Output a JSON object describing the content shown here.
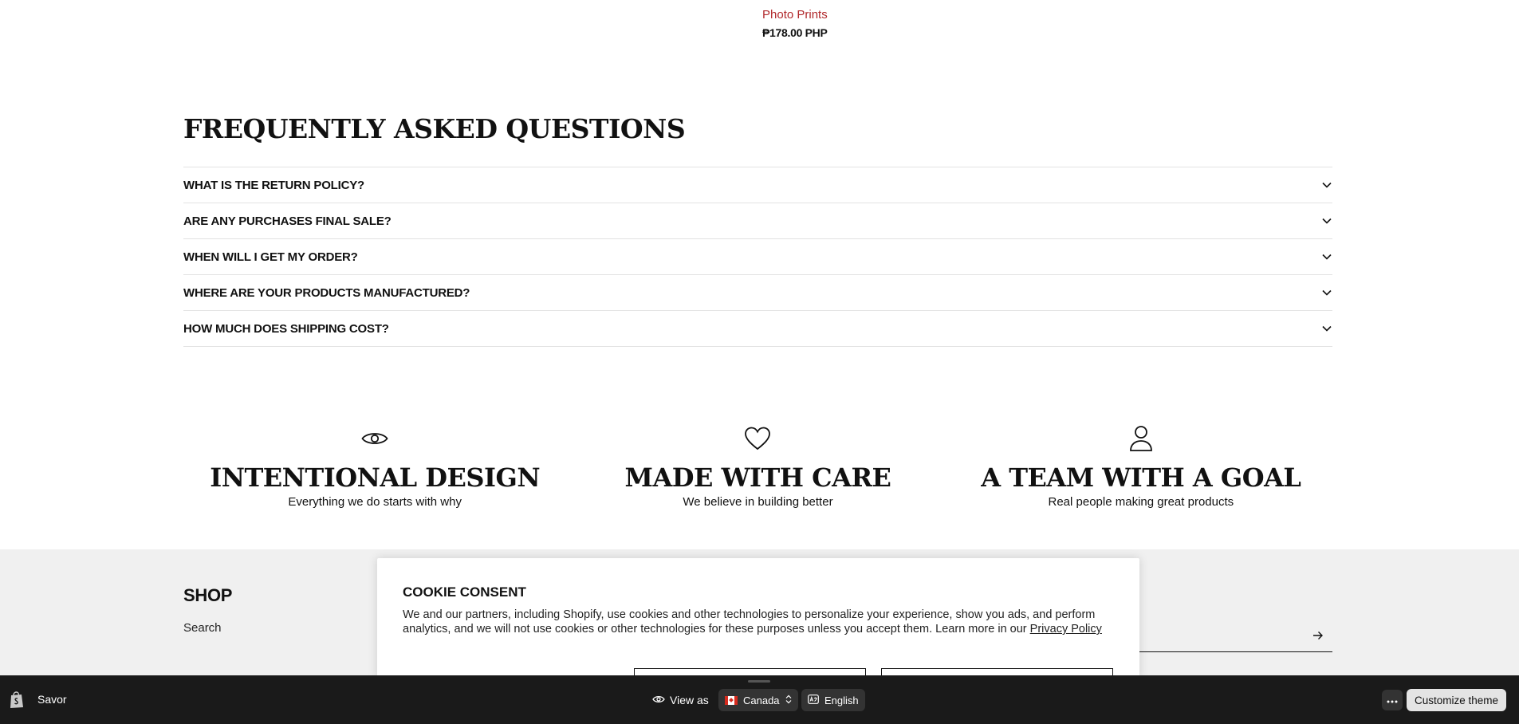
{
  "product": {
    "title": "Photo Prints",
    "price": "₱178.00 PHP"
  },
  "faq": {
    "title": "FREQUENTLY ASKED QUESTIONS",
    "items": [
      {
        "question": "WHAT IS THE RETURN POLICY?"
      },
      {
        "question": "ARE ANY PURCHASES FINAL SALE?"
      },
      {
        "question": "WHEN WILL I GET MY ORDER?"
      },
      {
        "question": "WHERE ARE YOUR PRODUCTS MANUFACTURED?"
      },
      {
        "question": "HOW MUCH DOES SHIPPING COST?"
      }
    ]
  },
  "values": [
    {
      "icon": "eye-icon",
      "title": "INTENTIONAL DESIGN",
      "subtitle": "Everything we do starts with why"
    },
    {
      "icon": "heart-icon",
      "title": "MADE WITH CARE",
      "subtitle": "We believe in building better"
    },
    {
      "icon": "person-icon",
      "title": "A TEAM WITH A GOAL",
      "subtitle": "Real people making great products"
    }
  ],
  "footer": {
    "shop_heading": "SHOP",
    "search_link": "Search"
  },
  "cookie": {
    "title": "COOKIE CONSENT",
    "text": "We and our partners, including Shopify, use cookies and other technologies to personalize your experience, show you ads, and perform analytics, and we will not use cookies or other technologies for these purposes unless you accept them. Learn more in our ",
    "link": "Privacy Policy"
  },
  "admin_bar": {
    "store_name": "Savor",
    "view_as": "View as",
    "country": "Canada",
    "language": "English",
    "customize": "Customize theme"
  },
  "colors": {
    "product_title": "#b1282b",
    "admin_bar_bg": "#1a1a1a",
    "footer_bg": "#f0f0f0"
  }
}
